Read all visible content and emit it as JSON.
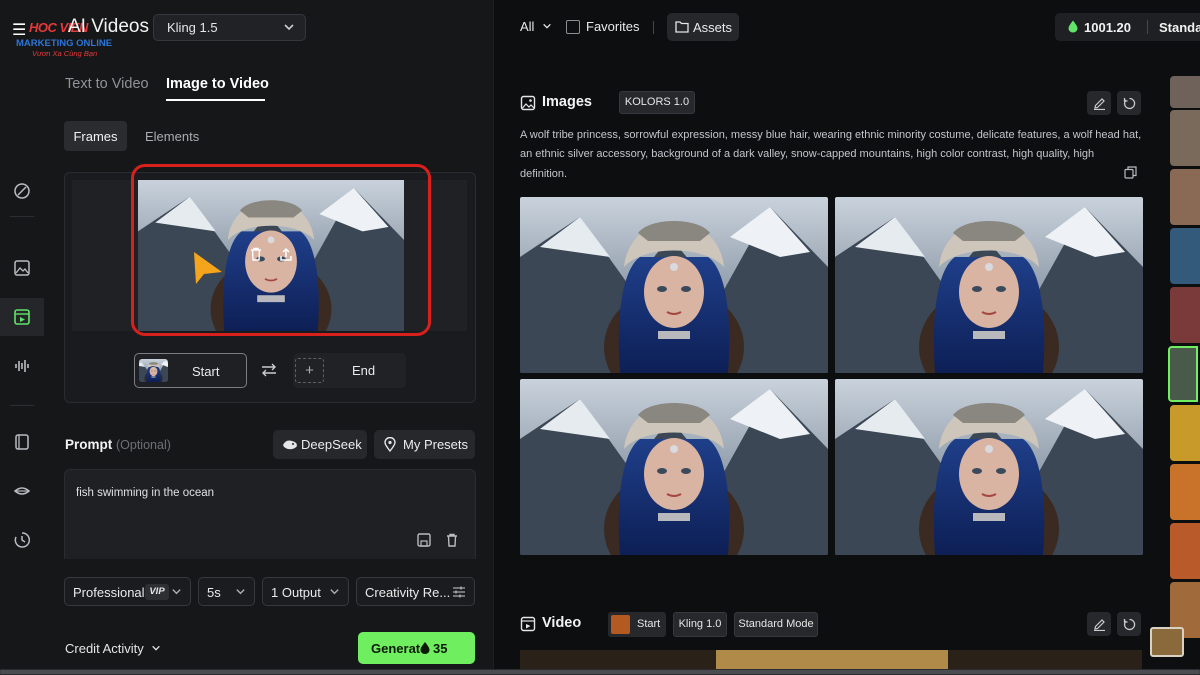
{
  "brand": {
    "logo_text": "HOC VIEN",
    "logo_line2": "MARKETING ONLINE",
    "logo_line3": "Vươn Xa Cùng Bạn"
  },
  "header": {
    "app_title": "AI Videos",
    "model": "Kling 1.5"
  },
  "tabs": [
    "Text to Video",
    "Image to Video"
  ],
  "subtabs": [
    "Frames",
    "Elements"
  ],
  "frames": {
    "start_label": "Start",
    "end_label": "End",
    "end_plus": "+"
  },
  "prompt": {
    "label": "Prompt",
    "optional": "(Optional)",
    "deepseek": "DeepSeek",
    "presets": "My Presets",
    "text": "fish swimming in the ocean"
  },
  "options": {
    "mode": "Professional",
    "vip": "VIP",
    "duration": "5s",
    "outputs": "1 Output",
    "creativity": "Creativity Re..."
  },
  "footer": {
    "credit_activity": "Credit Activity",
    "generate": "Generate",
    "cost": "35"
  },
  "topbar": {
    "filter": "All",
    "favorites": "Favorites",
    "assets": "Assets",
    "credits": "1001.20",
    "plan": "Standa"
  },
  "images_section": {
    "title": "Images",
    "badge": "KOLORS 1.0",
    "description": "A wolf tribe princess, sorrowful expression, messy blue hair, wearing ethnic minority costume, delicate features, a wolf head hat, an ethnic silver accessory, background of a dark valley, snow-capped mountains, high color contrast, high quality, high definition."
  },
  "video_section": {
    "title": "Video",
    "start": "Start",
    "model": "Kling 1.0",
    "mode": "Standard Mode"
  },
  "colors": {
    "accent_green": "#6fee5f",
    "highlight_red": "#d8201c",
    "panel_bg": "#161719",
    "page_bg": "#0d0e10"
  },
  "icons": {
    "rail": [
      "magic-icon",
      "image-icon",
      "video-icon",
      "audio-icon",
      "cube-icon",
      "lips-icon",
      "history-icon"
    ]
  }
}
